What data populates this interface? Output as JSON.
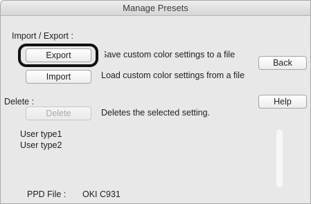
{
  "window": {
    "title": "Manage Presets"
  },
  "import_export": {
    "heading": "Import / Export :",
    "export_label": "Export",
    "export_desc": "Save custom color settings to a file",
    "import_label": "Import",
    "import_desc": "Load custom color settings from a file"
  },
  "side": {
    "back_label": "Back",
    "help_label": "Help"
  },
  "delete_section": {
    "heading": "Delete :",
    "delete_label": "Delete",
    "delete_desc": "Deletes the selected setting."
  },
  "presets": [
    {
      "label": "User type1"
    },
    {
      "label": "User type2"
    }
  ],
  "ppd": {
    "label": "PPD File :",
    "value": "OKI C931"
  },
  "colors": {
    "accent": "#5a88c7",
    "highlight_ring": "#111111",
    "window_bg": "#e8e8e8"
  }
}
